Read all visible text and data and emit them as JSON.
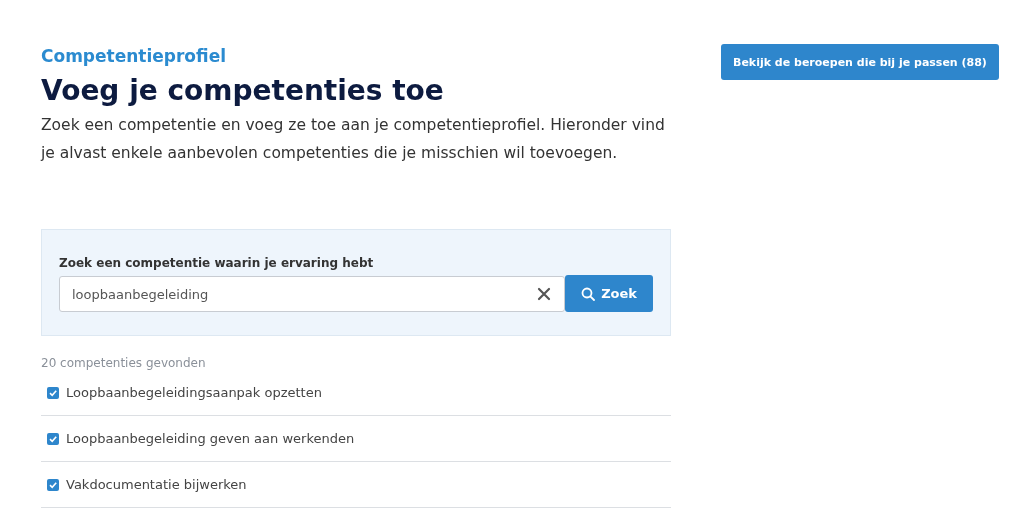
{
  "header": {
    "eyebrow": "Competentieprofiel",
    "title": "Voeg je competenties toe",
    "intro": "Zoek een competentie en voeg ze toe aan je competentieprofiel. Hieronder vind je alvast enkele aanbevolen competenties die je misschien wil toevoegen."
  },
  "action_button": "Bekijk de beroepen die bij je passen (88)",
  "search": {
    "label": "Zoek een competentie waarin je ervaring hebt",
    "value": "loopbaanbegeleiding",
    "button": "Zoek"
  },
  "result_count": "20 competenties gevonden",
  "results": [
    {
      "label": "Loopbaanbegeleidingsaanpak opzetten",
      "checked": true
    },
    {
      "label": "Loopbaanbegeleiding geven aan werkenden",
      "checked": true
    },
    {
      "label": "Vakdocumentatie bijwerken",
      "checked": true
    }
  ]
}
